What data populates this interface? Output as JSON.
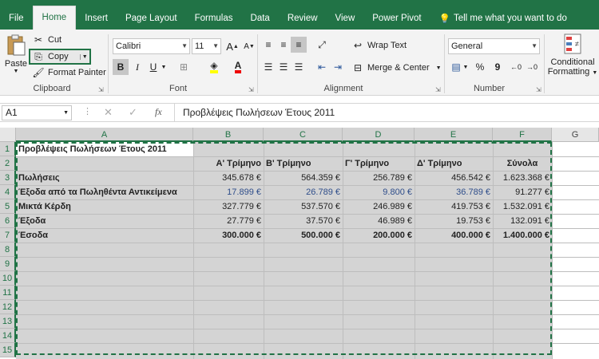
{
  "tabs": [
    "File",
    "Home",
    "Insert",
    "Page Layout",
    "Formulas",
    "Data",
    "Review",
    "View",
    "Power Pivot"
  ],
  "tell_me": "Tell me what you want to do",
  "clipboard": {
    "paste": "Paste",
    "cut": "Cut",
    "copy": "Copy",
    "format_painter": "Format Painter",
    "label": "Clipboard"
  },
  "font": {
    "name": "Calibri",
    "size": "11",
    "bold": "B",
    "italic": "I",
    "underline": "U",
    "label": "Font"
  },
  "alignment": {
    "wrap": "Wrap Text",
    "merge": "Merge & Center",
    "label": "Alignment"
  },
  "number": {
    "format": "General",
    "percent": "%",
    "comma": "9",
    "label": "Number"
  },
  "styles": {
    "conditional_line1": "Conditional",
    "conditional_line2": "Formatting"
  },
  "formula_bar": {
    "name_box": "A1",
    "fx": "fx",
    "content": "Προβλέψεις Πωλήσεων Έτους 2011"
  },
  "columns": [
    "A",
    "B",
    "C",
    "D",
    "E",
    "F",
    "G"
  ],
  "rows": [
    "1",
    "2",
    "3",
    "4",
    "5",
    "6",
    "7",
    "8",
    "9",
    "10",
    "11",
    "12",
    "13",
    "14",
    "15"
  ],
  "sheet": {
    "title": "Προβλέψεις Πωλήσεων Έτους 2011",
    "headers": [
      "Α' Τρίμηνο",
      "Β' Τρίμηνο",
      "Γ' Τρίμηνο",
      "Δ' Τρίμηνο",
      "Σύνολα"
    ],
    "data": [
      {
        "label": "Πωλήσεις",
        "values": [
          "345.678 €",
          "564.359 €",
          "256.789 €",
          "456.542 €",
          "1.623.368 €"
        ]
      },
      {
        "label": "Έξοδα από τα Πωληθέντα Αντικείμενα",
        "values": [
          "17.899 €",
          "26.789 €",
          "9.800 €",
          "36.789 €",
          "91.277 €"
        ]
      },
      {
        "label": "Μικτά Κέρδη",
        "values": [
          "327.779 €",
          "537.570 €",
          "246.989 €",
          "419.753 €",
          "1.532.091 €"
        ]
      },
      {
        "label": "Έξοδα",
        "values": [
          "27.779 €",
          "37.570 €",
          "46.989 €",
          "19.753 €",
          "132.091 €"
        ]
      },
      {
        "label": "Έσοδα",
        "values": [
          "300.000 €",
          "500.000 €",
          "200.000 €",
          "400.000 €",
          "1.400.000 €"
        ]
      }
    ]
  }
}
